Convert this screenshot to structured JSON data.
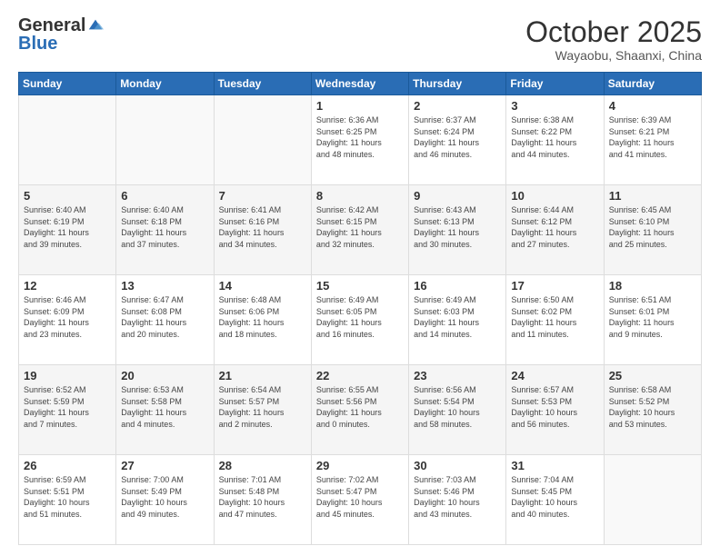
{
  "logo": {
    "general": "General",
    "blue": "Blue"
  },
  "title": {
    "month": "October 2025",
    "location": "Wayaobu, Shaanxi, China"
  },
  "weekdays": [
    "Sunday",
    "Monday",
    "Tuesday",
    "Wednesday",
    "Thursday",
    "Friday",
    "Saturday"
  ],
  "weeks": [
    [
      {
        "day": "",
        "info": ""
      },
      {
        "day": "",
        "info": ""
      },
      {
        "day": "",
        "info": ""
      },
      {
        "day": "1",
        "info": "Sunrise: 6:36 AM\nSunset: 6:25 PM\nDaylight: 11 hours\nand 48 minutes."
      },
      {
        "day": "2",
        "info": "Sunrise: 6:37 AM\nSunset: 6:24 PM\nDaylight: 11 hours\nand 46 minutes."
      },
      {
        "day": "3",
        "info": "Sunrise: 6:38 AM\nSunset: 6:22 PM\nDaylight: 11 hours\nand 44 minutes."
      },
      {
        "day": "4",
        "info": "Sunrise: 6:39 AM\nSunset: 6:21 PM\nDaylight: 11 hours\nand 41 minutes."
      }
    ],
    [
      {
        "day": "5",
        "info": "Sunrise: 6:40 AM\nSunset: 6:19 PM\nDaylight: 11 hours\nand 39 minutes."
      },
      {
        "day": "6",
        "info": "Sunrise: 6:40 AM\nSunset: 6:18 PM\nDaylight: 11 hours\nand 37 minutes."
      },
      {
        "day": "7",
        "info": "Sunrise: 6:41 AM\nSunset: 6:16 PM\nDaylight: 11 hours\nand 34 minutes."
      },
      {
        "day": "8",
        "info": "Sunrise: 6:42 AM\nSunset: 6:15 PM\nDaylight: 11 hours\nand 32 minutes."
      },
      {
        "day": "9",
        "info": "Sunrise: 6:43 AM\nSunset: 6:13 PM\nDaylight: 11 hours\nand 30 minutes."
      },
      {
        "day": "10",
        "info": "Sunrise: 6:44 AM\nSunset: 6:12 PM\nDaylight: 11 hours\nand 27 minutes."
      },
      {
        "day": "11",
        "info": "Sunrise: 6:45 AM\nSunset: 6:10 PM\nDaylight: 11 hours\nand 25 minutes."
      }
    ],
    [
      {
        "day": "12",
        "info": "Sunrise: 6:46 AM\nSunset: 6:09 PM\nDaylight: 11 hours\nand 23 minutes."
      },
      {
        "day": "13",
        "info": "Sunrise: 6:47 AM\nSunset: 6:08 PM\nDaylight: 11 hours\nand 20 minutes."
      },
      {
        "day": "14",
        "info": "Sunrise: 6:48 AM\nSunset: 6:06 PM\nDaylight: 11 hours\nand 18 minutes."
      },
      {
        "day": "15",
        "info": "Sunrise: 6:49 AM\nSunset: 6:05 PM\nDaylight: 11 hours\nand 16 minutes."
      },
      {
        "day": "16",
        "info": "Sunrise: 6:49 AM\nSunset: 6:03 PM\nDaylight: 11 hours\nand 14 minutes."
      },
      {
        "day": "17",
        "info": "Sunrise: 6:50 AM\nSunset: 6:02 PM\nDaylight: 11 hours\nand 11 minutes."
      },
      {
        "day": "18",
        "info": "Sunrise: 6:51 AM\nSunset: 6:01 PM\nDaylight: 11 hours\nand 9 minutes."
      }
    ],
    [
      {
        "day": "19",
        "info": "Sunrise: 6:52 AM\nSunset: 5:59 PM\nDaylight: 11 hours\nand 7 minutes."
      },
      {
        "day": "20",
        "info": "Sunrise: 6:53 AM\nSunset: 5:58 PM\nDaylight: 11 hours\nand 4 minutes."
      },
      {
        "day": "21",
        "info": "Sunrise: 6:54 AM\nSunset: 5:57 PM\nDaylight: 11 hours\nand 2 minutes."
      },
      {
        "day": "22",
        "info": "Sunrise: 6:55 AM\nSunset: 5:56 PM\nDaylight: 11 hours\nand 0 minutes."
      },
      {
        "day": "23",
        "info": "Sunrise: 6:56 AM\nSunset: 5:54 PM\nDaylight: 10 hours\nand 58 minutes."
      },
      {
        "day": "24",
        "info": "Sunrise: 6:57 AM\nSunset: 5:53 PM\nDaylight: 10 hours\nand 56 minutes."
      },
      {
        "day": "25",
        "info": "Sunrise: 6:58 AM\nSunset: 5:52 PM\nDaylight: 10 hours\nand 53 minutes."
      }
    ],
    [
      {
        "day": "26",
        "info": "Sunrise: 6:59 AM\nSunset: 5:51 PM\nDaylight: 10 hours\nand 51 minutes."
      },
      {
        "day": "27",
        "info": "Sunrise: 7:00 AM\nSunset: 5:49 PM\nDaylight: 10 hours\nand 49 minutes."
      },
      {
        "day": "28",
        "info": "Sunrise: 7:01 AM\nSunset: 5:48 PM\nDaylight: 10 hours\nand 47 minutes."
      },
      {
        "day": "29",
        "info": "Sunrise: 7:02 AM\nSunset: 5:47 PM\nDaylight: 10 hours\nand 45 minutes."
      },
      {
        "day": "30",
        "info": "Sunrise: 7:03 AM\nSunset: 5:46 PM\nDaylight: 10 hours\nand 43 minutes."
      },
      {
        "day": "31",
        "info": "Sunrise: 7:04 AM\nSunset: 5:45 PM\nDaylight: 10 hours\nand 40 minutes."
      },
      {
        "day": "",
        "info": ""
      }
    ]
  ],
  "colors": {
    "header_bg": "#2a6db5",
    "row_shade": "#f5f5f5"
  }
}
